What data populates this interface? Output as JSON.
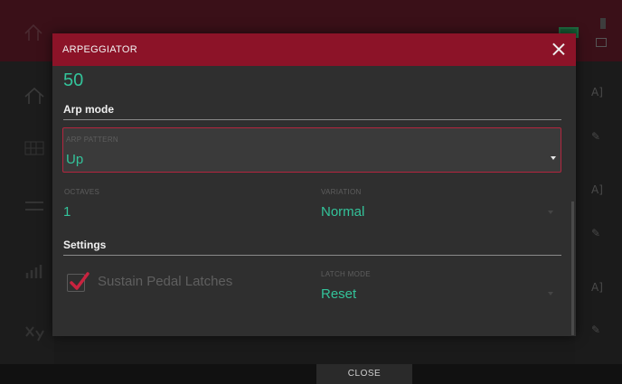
{
  "dialog": {
    "title": "ARPEGGIATOR",
    "top_value": "50",
    "arp_mode": {
      "heading": "Arp mode",
      "pattern_label": "ARP PATTERN",
      "pattern_value": "Up",
      "octaves_label": "OCTAVES",
      "octaves_value": "1",
      "variation_label": "VARIATION",
      "variation_value": "Normal"
    },
    "settings": {
      "heading": "Settings",
      "sustain_label": "Sustain Pedal Latches",
      "sustain_checked": true,
      "latch_mode_label": "LATCH MODE",
      "latch_mode_value": "Reset"
    }
  },
  "footer": {
    "close_label": "CLOSE"
  },
  "background": {
    "right_rail_icons": [
      "A]",
      "pencil-icon",
      "A]",
      "pencil-icon",
      "A]",
      "pencil-icon"
    ]
  },
  "colors": {
    "header_red": "#8c1328",
    "accent_green": "#33c39a",
    "focus_border": "#b3263f"
  }
}
